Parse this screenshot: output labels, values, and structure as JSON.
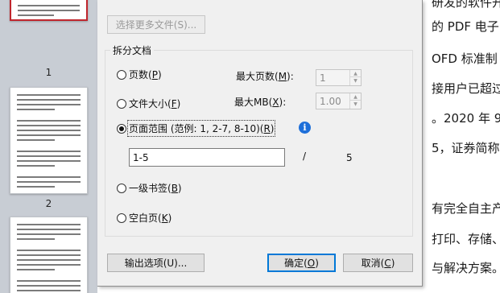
{
  "thumbnails": [
    {
      "page": "1"
    },
    {
      "page": "2"
    },
    {
      "page": ""
    }
  ],
  "document_text": [
    "研发的软件开发",
    "的 PDF 电子",
    "OFD 标准制",
    "接用户已超过",
    "。2020 年 9",
    "5，证券简称",
    "",
    "有完全自主产",
    "打印、存储、",
    "与解决方案。"
  ],
  "dialog": {
    "select_files_button": "选择更多文件(S)...",
    "group_title": "拆分文档",
    "options": {
      "pages": {
        "label": "页数(",
        "key": "P",
        "close": ")"
      },
      "file_size": {
        "label": "文件大小(",
        "key": "F",
        "close": ")"
      },
      "page_range": {
        "label": "页面范围 (范例:  1, 2-7, 8-10)(",
        "key": "R",
        "close": ")"
      },
      "bookmark": {
        "label": "一级书签(",
        "key": "B",
        "close": ")"
      },
      "blank_page": {
        "label": "空白页(",
        "key": "K",
        "close": ")"
      }
    },
    "max_pages": {
      "label": "最大页数(",
      "key": "M",
      "close": "):",
      "value": "1"
    },
    "max_mb": {
      "label": "最大MB(",
      "key": "X",
      "close": "):",
      "value": "1.00"
    },
    "range_input": "1-5",
    "range_separator": "/",
    "total_pages": "5",
    "output_options_button": "输出选项(U)...",
    "ok_button": {
      "label": "确定(",
      "key": "O",
      "close": ")"
    },
    "cancel_button": {
      "label": "取消(",
      "key": "C",
      "close": ")"
    }
  }
}
